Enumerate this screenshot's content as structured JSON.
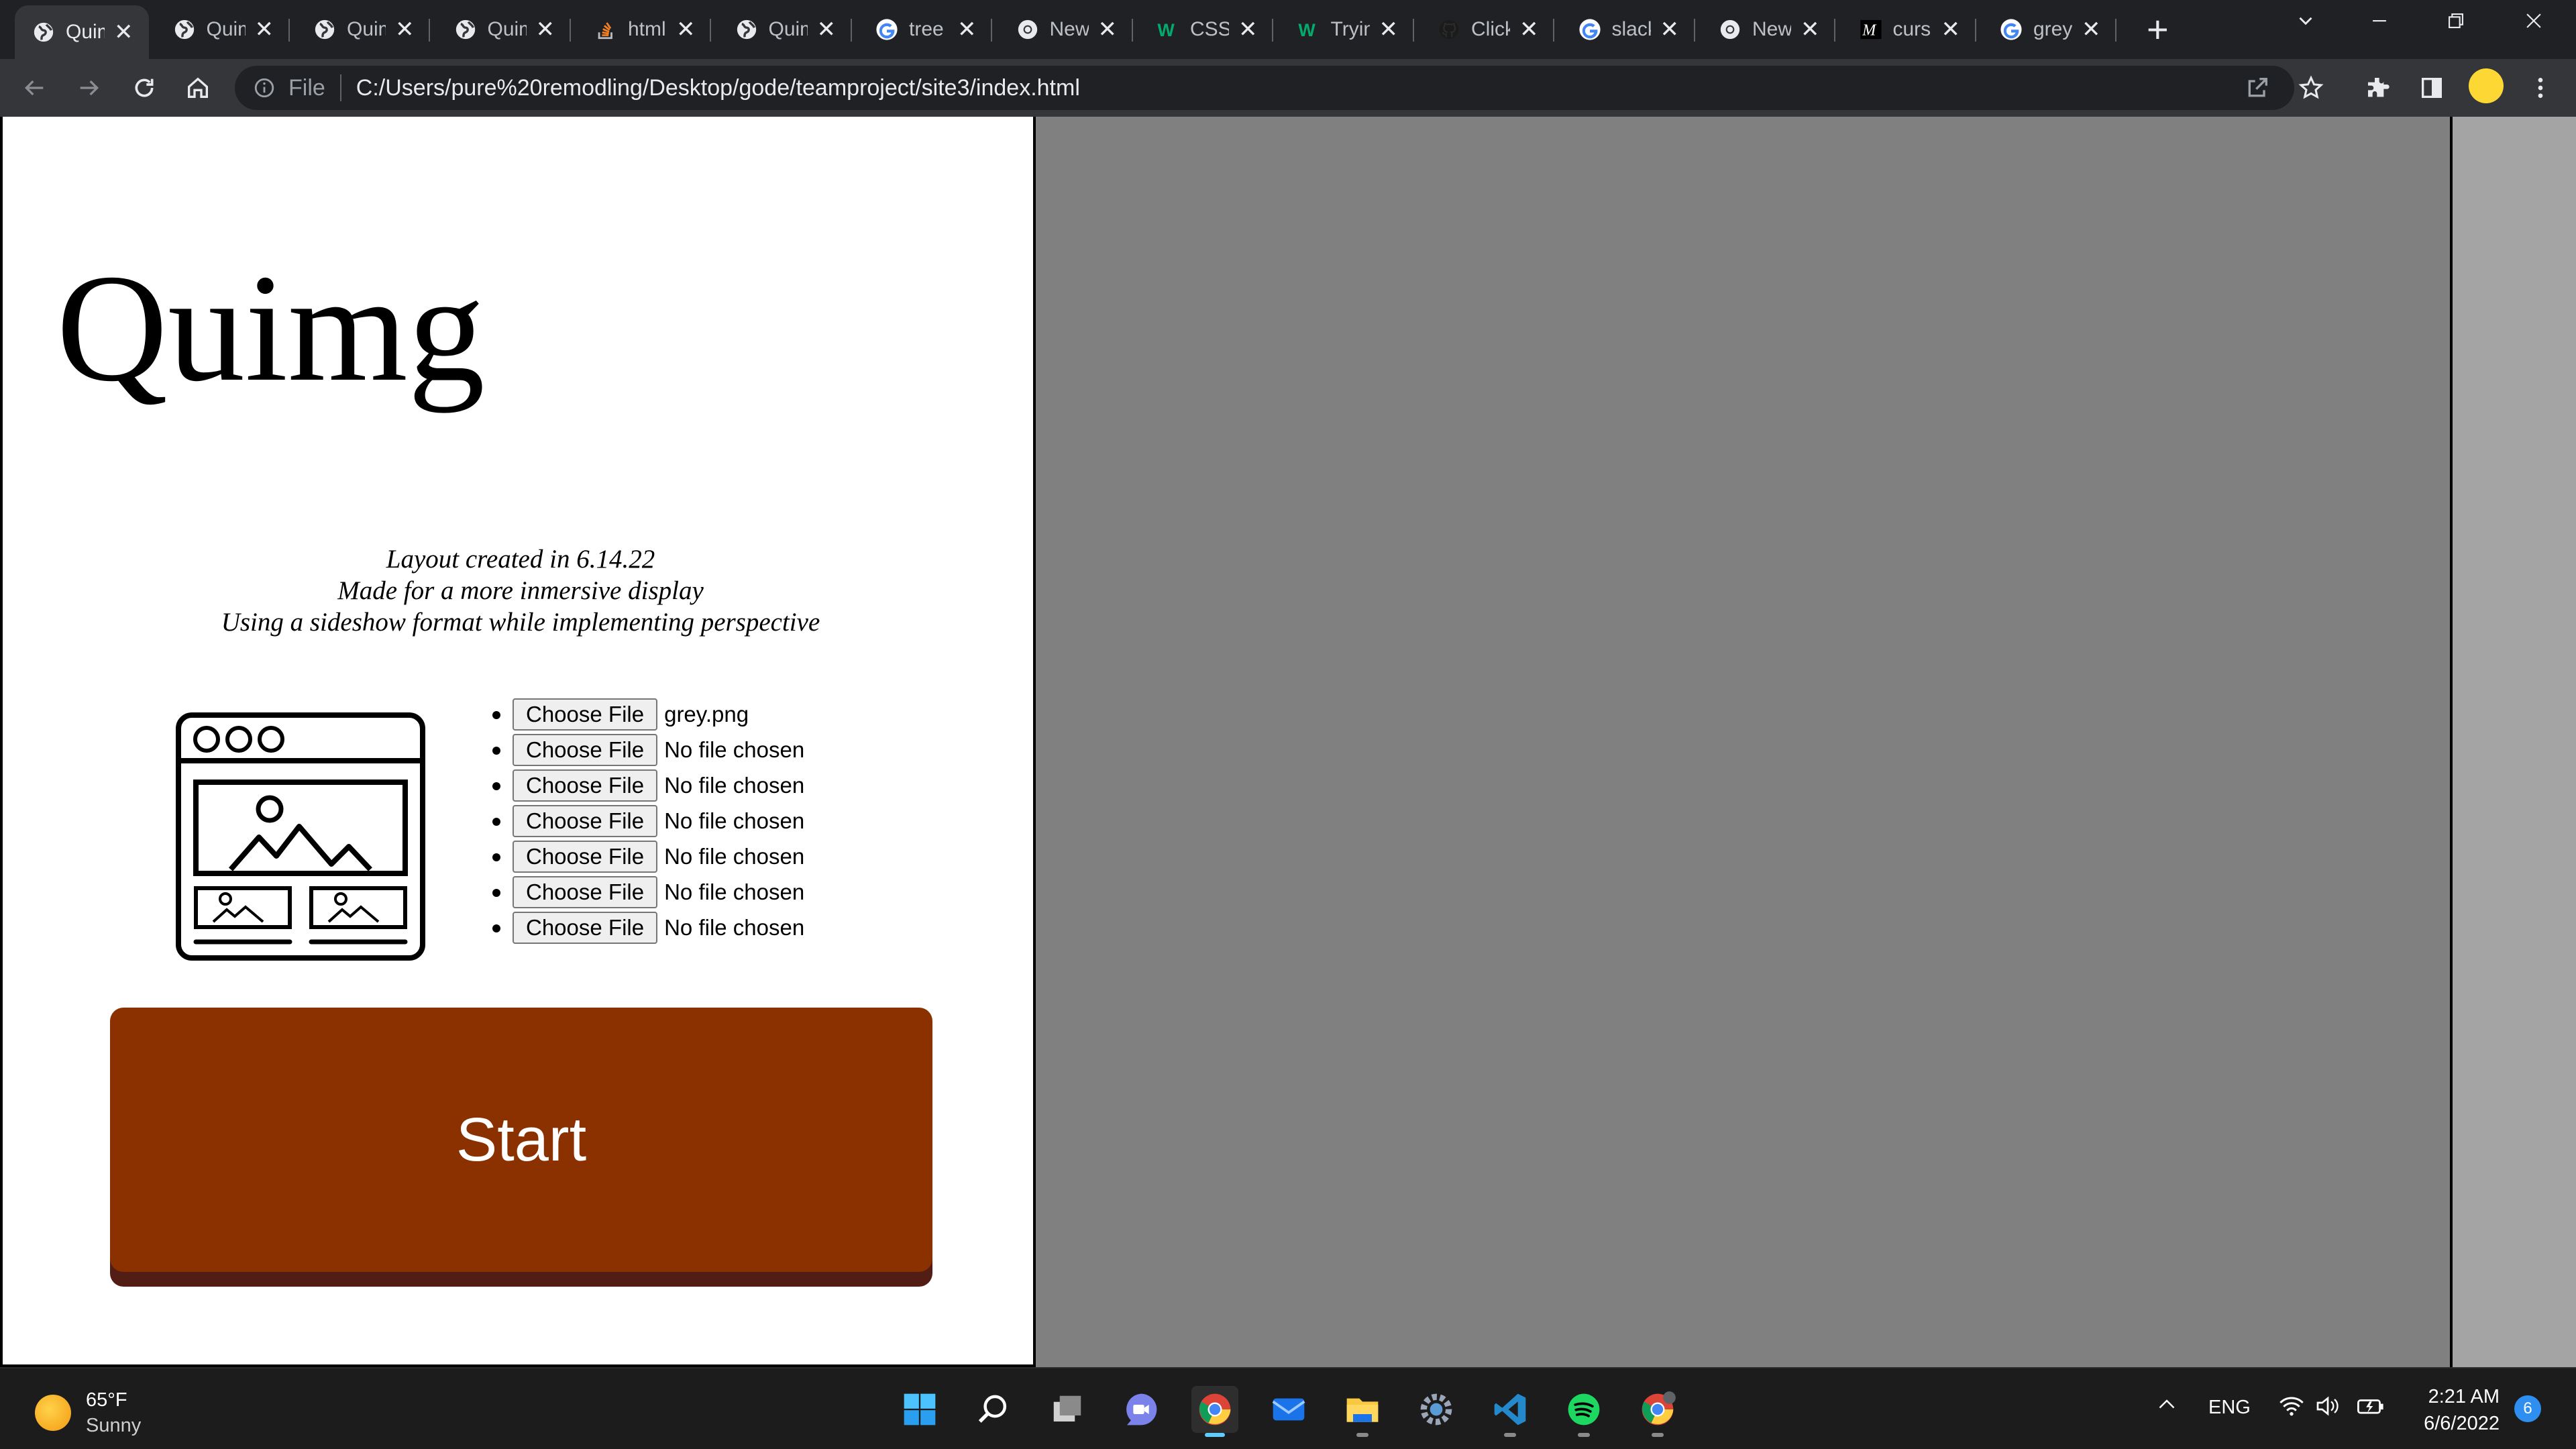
{
  "browser": {
    "tabs": [
      {
        "title": "Quimg",
        "icon": "globe-icon",
        "active": true
      },
      {
        "title": "Quimg",
        "icon": "globe-icon"
      },
      {
        "title": "Quimg",
        "icon": "globe-icon"
      },
      {
        "title": "Quimg",
        "icon": "globe-icon"
      },
      {
        "title": "html",
        "icon": "stackoverflow-icon"
      },
      {
        "title": "Quimg",
        "icon": "globe-icon"
      },
      {
        "title": "tree",
        "icon": "google-icon"
      },
      {
        "title": "New",
        "icon": "chrome-icon"
      },
      {
        "title": "CSS",
        "icon": "w3schools-icon"
      },
      {
        "title": "Trying",
        "icon": "w3schools-icon"
      },
      {
        "title": "Click",
        "icon": "github-icon"
      },
      {
        "title": "slack",
        "icon": "google-icon"
      },
      {
        "title": "New",
        "icon": "chrome-icon"
      },
      {
        "title": "curs",
        "icon": "m-icon"
      },
      {
        "title": "grey",
        "icon": "google-icon"
      }
    ],
    "address": {
      "scheme": "File",
      "url": "C:/Users/pure%20remodling/Desktop/gode/teamproject/site3/index.html"
    }
  },
  "page": {
    "title": "Quimg",
    "description": [
      "Layout created in 6.14.22",
      "Made for a more inmersive display",
      "Using a sideshow format while implementing perspective"
    ],
    "choose_label": "Choose File",
    "file_inputs": [
      "grey.png",
      "No file chosen",
      "No file chosen",
      "No file chosen",
      "No file chosen",
      "No file chosen",
      "No file chosen"
    ],
    "start_label": "Start",
    "colors": {
      "start_bg": "#8b3100",
      "start_shadow": "#521d14",
      "panel_bg": "#808080",
      "right_panel_bg": "#a4a4a4"
    }
  },
  "taskbar": {
    "weather": {
      "temp": "65°F",
      "condition": "Sunny"
    },
    "language": "ENG",
    "time": "2:21 AM",
    "date": "6/6/2022",
    "notifications": "6",
    "apps": [
      "windows-start-icon",
      "search-icon",
      "task-view-icon",
      "teams-chat-icon",
      "chrome-icon",
      "mail-icon",
      "file-explorer-icon",
      "settings-icon",
      "vscode-icon",
      "spotify-icon",
      "chrome-profile-icon"
    ]
  }
}
